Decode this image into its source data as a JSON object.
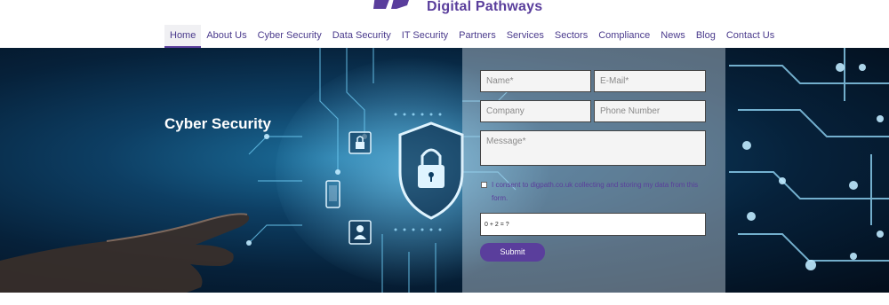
{
  "brand": {
    "name": "Digital Pathways",
    "accent": "#5a3e9c"
  },
  "nav": {
    "items": [
      {
        "label": "Home",
        "active": true
      },
      {
        "label": "About Us"
      },
      {
        "label": "Cyber Security"
      },
      {
        "label": "Data Security"
      },
      {
        "label": "IT Security"
      },
      {
        "label": "Partners"
      },
      {
        "label": "Services"
      },
      {
        "label": "Sectors"
      },
      {
        "label": "Compliance"
      },
      {
        "label": "News"
      },
      {
        "label": "Blog"
      },
      {
        "label": "Contact Us"
      }
    ]
  },
  "hero": {
    "title": "Cyber Security",
    "icons": [
      "shield-lock-icon",
      "lock-icon",
      "mobile-icon",
      "user-icon",
      "hand-icon"
    ]
  },
  "form": {
    "name_placeholder": "Name*",
    "email_placeholder": "E-Mail*",
    "company_placeholder": "Company",
    "phone_placeholder": "Phone Number",
    "message_placeholder": "Message*",
    "consent_text": "I consent to digpath.co.uk collecting and storing my data from this form.",
    "captcha": "0 + 2 = ?",
    "submit_label": "Submit"
  }
}
